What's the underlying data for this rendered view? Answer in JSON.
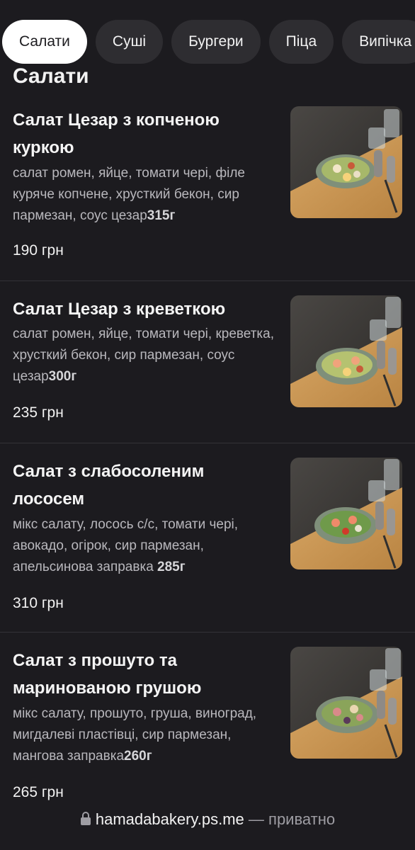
{
  "categories": [
    {
      "label": "Салати",
      "active": true
    },
    {
      "label": "Суші",
      "active": false
    },
    {
      "label": "Бургери",
      "active": false
    },
    {
      "label": "Піца",
      "active": false
    },
    {
      "label": "Випічка",
      "active": false
    }
  ],
  "section_title": "Салати",
  "items": [
    {
      "name": "Салат Цезар з копченою куркою",
      "description": "салат ромен, яйце, томати чері, філе куряче копчене, хрусткий бекон, сир пармезан, соус цезар",
      "weight": "315г",
      "price": "190 грн"
    },
    {
      "name": "Салат Цезар з креветкою",
      "description": "салат ромен, яйце, томати чері, креветка, хрусткий бекон, сир пармезан, соус цезар",
      "weight": "300г",
      "price": "235 грн"
    },
    {
      "name": "Салат з слабосоленим лососем",
      "description": "мікс салату, лосось с/с, томати чері, авокадо, огірок, сир пармезан, апельсинова заправка ",
      "weight": "285г",
      "price": "310 грн"
    },
    {
      "name": "Салат з прошуто та маринованою грушою",
      "description": "мікс салату, прошуто, груша, виноград, мигдалеві пластівці, сир пармезан, мангова заправка",
      "weight": "260г",
      "price": "265 грн"
    }
  ],
  "browser": {
    "domain": "hamadabakery.ps.me",
    "separator": " — ",
    "privacy": "приватно"
  },
  "icons": {
    "lock": "lock-icon"
  },
  "colors": {
    "background": "#1c1b1f",
    "chip": "#2e2d31",
    "chip_active": "#ffffff",
    "muted_text": "#b9b8bd"
  }
}
